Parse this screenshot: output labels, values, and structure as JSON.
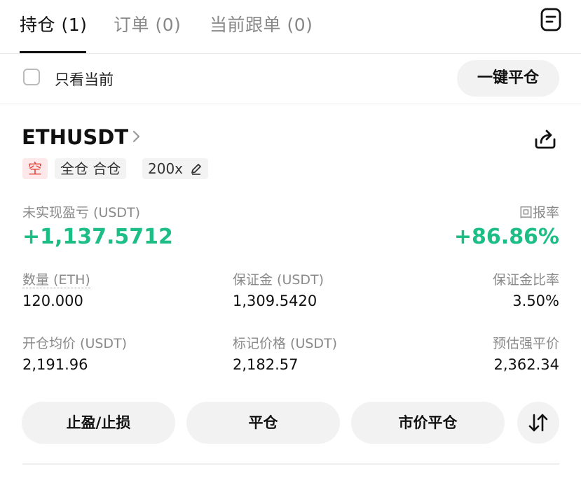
{
  "tabs": [
    {
      "label": "持仓 (1)",
      "active": true
    },
    {
      "label": "订单 (0)",
      "active": false
    },
    {
      "label": "当前跟单 (0)",
      "active": false
    }
  ],
  "filter": {
    "label": "只看当前",
    "checked": false
  },
  "close_all_button": "一键平仓",
  "position": {
    "symbol": "ETHUSDT",
    "tags": {
      "side": "空",
      "mode": "全仓 合仓",
      "leverage": "200x"
    },
    "unrealized_pnl_label": "未实现盈亏 (USDT)",
    "unrealized_pnl": "+1,137.5712",
    "roi_label": "回报率",
    "roi": "+86.86%",
    "quantity_label": "数量 (ETH)",
    "quantity": "120.000",
    "margin_label": "保证金 (USDT)",
    "margin": "1,309.5420",
    "margin_ratio_label": "保证金比率",
    "margin_ratio": "3.50%",
    "entry_price_label": "开仓均价 (USDT)",
    "entry_price": "2,191.96",
    "mark_price_label": "标记价格 (USDT)",
    "mark_price": "2,182.57",
    "liq_price_label": "预估强平价",
    "liq_price": "2,362.34"
  },
  "actions": {
    "tp_sl": "止盈/止损",
    "close": "平仓",
    "market_close": "市价平仓"
  },
  "colors": {
    "green": "#1dbd86",
    "red": "#e5413b"
  }
}
